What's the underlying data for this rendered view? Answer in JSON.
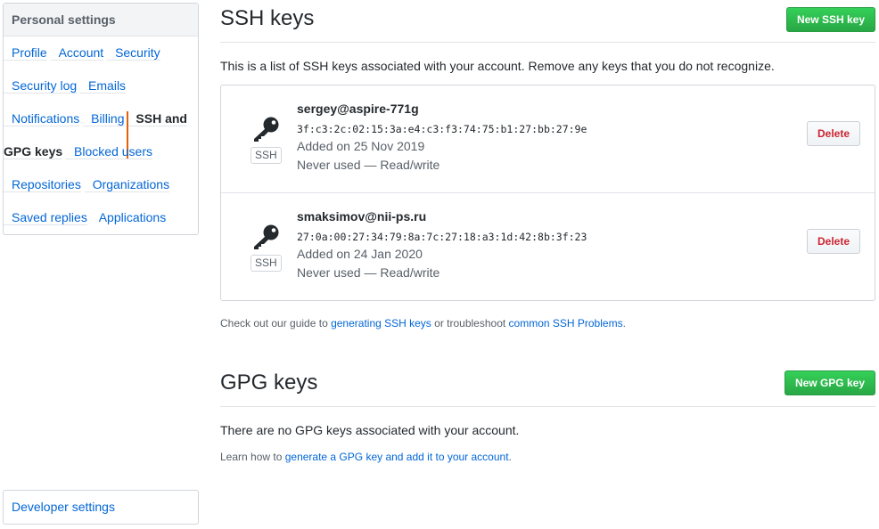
{
  "sidebar": {
    "heading": "Personal settings",
    "items": [
      {
        "label": "Profile"
      },
      {
        "label": "Account"
      },
      {
        "label": "Security"
      },
      {
        "label": "Security log"
      },
      {
        "label": "Emails"
      },
      {
        "label": "Notifications"
      },
      {
        "label": "Billing"
      },
      {
        "label": "SSH and GPG keys"
      },
      {
        "label": "Blocked users"
      },
      {
        "label": "Repositories"
      },
      {
        "label": "Organizations"
      },
      {
        "label": "Saved replies"
      },
      {
        "label": "Applications"
      }
    ],
    "selected": "SSH and GPG keys",
    "developer_settings": "Developer settings"
  },
  "ssh": {
    "title": "SSH keys",
    "new_button": "New SSH key",
    "intro": "This is a list of SSH keys associated with your account. Remove any keys that you do not recognize.",
    "keys": [
      {
        "title": "sergey@aspire-771g",
        "fingerprint": "3f:c3:2c:02:15:3a:e4:c3:f3:74:75:b1:27:bb:27:9e",
        "added": "Added on 25 Nov 2019",
        "usage": "Never used — Read/write",
        "label": "SSH",
        "delete": "Delete"
      },
      {
        "title": "smaksimov@nii-ps.ru",
        "fingerprint": "27:0a:00:27:34:79:8a:7c:27:18:a3:1d:42:8b:3f:23",
        "added": "Added on 24 Jan 2020",
        "usage": "Never used — Read/write",
        "label": "SSH",
        "delete": "Delete"
      }
    ],
    "note": {
      "prefix": "Check out our guide to ",
      "link1": "generating SSH keys",
      "middle": " or troubleshoot ",
      "link2": "common SSH Problems",
      "suffix": "."
    }
  },
  "gpg": {
    "title": "GPG keys",
    "new_button": "New GPG key",
    "empty": "There are no GPG keys associated with your account.",
    "note": {
      "prefix": "Learn how to ",
      "link": "generate a GPG key and add it to your account",
      "suffix": "."
    }
  },
  "colors": {
    "link": "#0366d6",
    "primary_button": "#28a745",
    "danger_text": "#cb2431",
    "selected_indicator": "#e36209"
  },
  "icons": [
    "key-icon"
  ]
}
